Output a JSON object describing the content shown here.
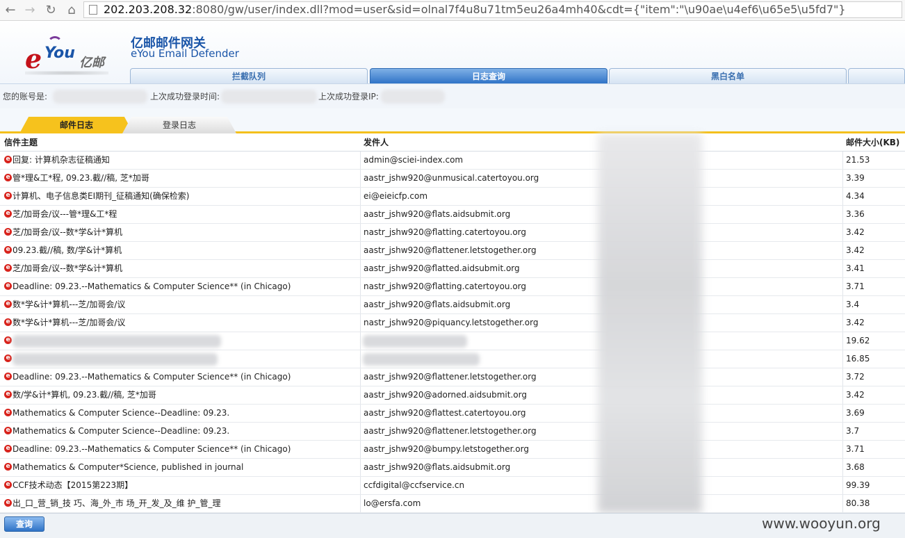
{
  "browser": {
    "url_host": "202.203.208.32",
    "url_rest": ":8080/gw/user/index.dll?mod=user&sid=olnal7f4u8u71tm5eu26a4mh40&cdt={\"item\":\"\\u90ae\\u4ef6\\u65e5\\u5fd7\"}"
  },
  "header": {
    "brand_cn": "亿邮邮件网关",
    "brand_en": "eYou Email Defender",
    "logo_e": "e",
    "logo_you": "You",
    "logo_cn": "亿邮",
    "tabs": [
      {
        "label": "拦截队列",
        "active": false
      },
      {
        "label": "日志查询",
        "active": true
      },
      {
        "label": "黑白名单",
        "active": false
      },
      {
        "label": "",
        "active": false
      }
    ]
  },
  "account": {
    "account_label": "您的账号是:",
    "last_login_time_label": "上次成功登录时间:",
    "last_login_ip_label": "上次成功登录IP:"
  },
  "subtabs": [
    {
      "label": "邮件日志",
      "active": true
    },
    {
      "label": "登录日志",
      "active": false
    }
  ],
  "table": {
    "headers": {
      "subject": "信件主题",
      "sender": "发件人",
      "size": "邮件大小(KB)"
    },
    "rows": [
      {
        "subject": "回复: 计算机杂志征稿通知",
        "sender": "admin@sciei-index.com",
        "size": "21.53"
      },
      {
        "subject": "管*理&工*程, 09.23.截//稿, 芝*加哥",
        "sender": "aastr_jshw920@unmusical.catertoyou.org",
        "size": "3.39"
      },
      {
        "subject": "计算机、电子信息类EI期刊_征稿通知(确保检索)",
        "sender": "ei@eieicfp.com",
        "size": "4.34"
      },
      {
        "subject": "芝/加哥会/议---管*理&工*程",
        "sender": "aastr_jshw920@flats.aidsubmit.org",
        "size": "3.36"
      },
      {
        "subject": "芝/加哥会/议--数*学&计*算机",
        "sender": "nastr_jshw920@flatting.catertoyou.org",
        "size": "3.42"
      },
      {
        "subject": "09.23.截//稿, 数/学&计*算机",
        "sender": "aastr_jshw920@flattener.letstogether.org",
        "size": "3.42"
      },
      {
        "subject": "芝/加哥会/议--数*学&计*算机",
        "sender": "aastr_jshw920@flatted.aidsubmit.org",
        "size": "3.41"
      },
      {
        "subject": "Deadline: 09.23.--Mathematics & Computer Science** (in Chicago)",
        "sender": "nastr_jshw920@flatting.catertoyou.org",
        "size": "3.71"
      },
      {
        "subject": "数*学&计*算机---芝/加哥会/议",
        "sender": "aastr_jshw920@flats.aidsubmit.org",
        "size": "3.4"
      },
      {
        "subject": "数*学&计*算机---芝/加哥会/议",
        "sender": "nastr_jshw920@piquancy.letstogether.org",
        "size": "3.42"
      },
      {
        "subject": "",
        "sender": "",
        "size": "19.62",
        "redacted": true
      },
      {
        "subject": "",
        "sender": "",
        "size": "16.85",
        "redacted": true
      },
      {
        "subject": "Deadline: 09.23.--Mathematics & Computer Science** (in Chicago)",
        "sender": "aastr_jshw920@flattener.letstogether.org",
        "size": "3.72"
      },
      {
        "subject": "数/学&计*算机, 09.23.截//稿, 芝*加哥",
        "sender": "aastr_jshw920@adorned.aidsubmit.org",
        "size": "3.42"
      },
      {
        "subject": "Mathematics & Computer Science--Deadline: 09.23.",
        "sender": "aastr_jshw920@flattest.catertoyou.org",
        "size": "3.69"
      },
      {
        "subject": "Mathematics & Computer Science--Deadline: 09.23.",
        "sender": "aastr_jshw920@flattener.letstogether.org",
        "size": "3.7"
      },
      {
        "subject": "Deadline: 09.23.--Mathematics & Computer Science** (in Chicago)",
        "sender": "aastr_jshw920@bumpy.letstogether.org",
        "size": "3.71"
      },
      {
        "subject": "Mathematics & Computer*Science, published in journal",
        "sender": "aastr_jshw920@flats.aidsubmit.org",
        "size": "3.68"
      },
      {
        "subject": "CCF技术动态【2015第223期】",
        "sender": "ccfdigital@ccfservice.cn",
        "size": "99.39"
      },
      {
        "subject": "出_口_营_销_技 巧、海_外_市 场_开_发_及_维 护_管_理",
        "sender": "lo@ersfa.com",
        "size": "80.38"
      }
    ]
  },
  "bottom": {
    "query_button": "查询",
    "watermark": "www.wooyun.org"
  },
  "colors": {
    "accent_blue": "#2f73c7",
    "tab_yellow": "#f6c21d",
    "mail_icon_red": "#d8231c"
  }
}
